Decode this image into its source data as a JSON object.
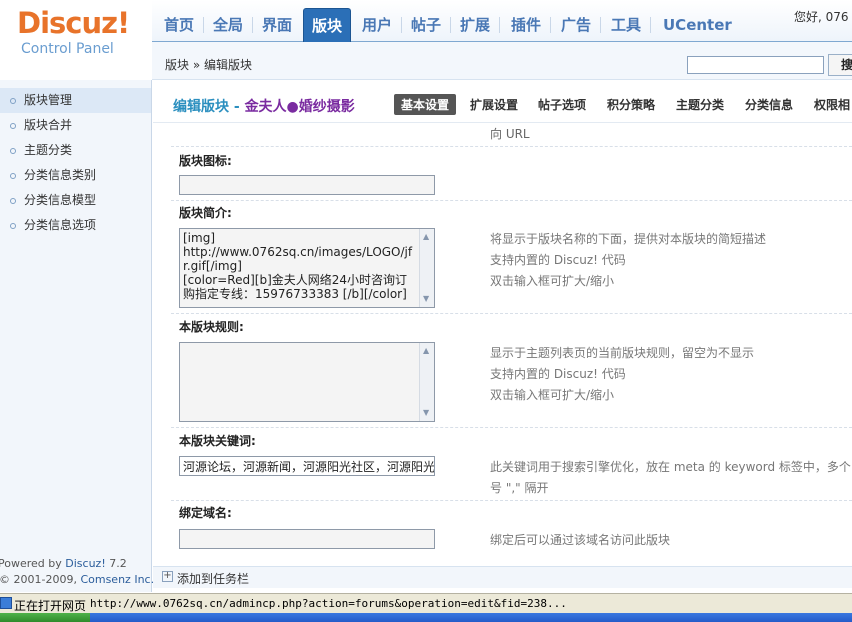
{
  "brand": {
    "logo": "Discuz!",
    "logo_sub": "Control Panel"
  },
  "nav": {
    "items": [
      {
        "label": "首页"
      },
      {
        "label": "全局"
      },
      {
        "label": "界面"
      },
      {
        "label": "版块"
      },
      {
        "label": "用户"
      },
      {
        "label": "帖子"
      },
      {
        "label": "扩展"
      },
      {
        "label": "插件"
      },
      {
        "label": "广告"
      },
      {
        "label": "工具"
      },
      {
        "label": "UCenter"
      }
    ],
    "active_index": 3,
    "greeting": "您好, 076"
  },
  "breadcrumb": "版块 » 编辑版块",
  "search": {
    "button_label": "搜"
  },
  "sidebar": {
    "items": [
      {
        "label": "版块管理"
      },
      {
        "label": "版块合并"
      },
      {
        "label": "主题分类"
      },
      {
        "label": "分类信息类别"
      },
      {
        "label": "分类信息模型"
      },
      {
        "label": "分类信息选项"
      }
    ],
    "active_index": 0,
    "powered_prefix": "Powered by ",
    "powered_brand": "Discuz!",
    "powered_version": " 7.2",
    "copyright_prefix": "© 2001-2009, ",
    "copyright_brand": "Comsenz Inc."
  },
  "page": {
    "title": "编辑版块",
    "title_sep": " - ",
    "forum_name": "金夫人●婚纱摄影",
    "tabs": [
      {
        "label": "基本设置"
      },
      {
        "label": "扩展设置"
      },
      {
        "label": "帖子选项"
      },
      {
        "label": "积分策略"
      },
      {
        "label": "主题分类"
      },
      {
        "label": "分类信息"
      },
      {
        "label": "权限相"
      }
    ],
    "active_tab": 0,
    "url_tail": "向 URL"
  },
  "fields": {
    "icon": {
      "label": "版块图标:",
      "value": ""
    },
    "description": {
      "label": "版块简介:",
      "value": "[img]\nhttp://www.0762sq.cn/images/LOGO/jfr.gif[/img]\n[color=Red][b]金夫人网络24小时咨询订购指定专线：15976733383 [/b][/color]",
      "tips": [
        "将显示于版块名称的下面，提供对本版块的简短描述",
        "支持内置的 Discuz! 代码",
        "双击输入框可扩大/缩小"
      ]
    },
    "rules": {
      "label": "本版块规则:",
      "value": "",
      "tips": [
        "显示于主题列表页的当前版块规则，留空为不显示",
        "支持内置的 Discuz! 代码",
        "双击输入框可扩大/缩小"
      ]
    },
    "keywords": {
      "label": "本版块关键词:",
      "value": "河源论坛，河源新闻，河源阳光社区，河源阳光",
      "tips": [
        "此关键词用于搜索引擎优化，放在 meta 的 keyword 标签中，多个",
        "号 \",\" 隔开"
      ]
    },
    "domain": {
      "label": "绑定域名:",
      "value": "",
      "tips": [
        "绑定后可以通过该域名访问此版块"
      ]
    }
  },
  "taskbar": {
    "add_label": "添加到任务栏"
  },
  "statusbar": {
    "text": "正在打开网页",
    "url": "http://www.0762sq.cn/admincp.php?action=forums&operation=edit&fid=238..."
  }
}
